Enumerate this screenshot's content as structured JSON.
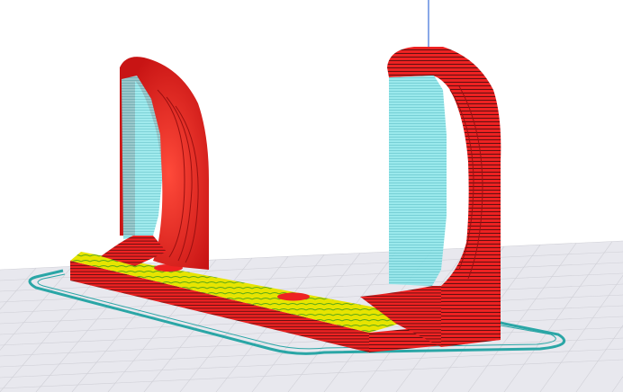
{
  "viewport": {
    "label": "",
    "colors": {
      "background": "#ffffff",
      "build_plate": "#e8e8ee",
      "grid_line": "#cfcfd6",
      "z_axis": "#3b6fd8",
      "wall_red": "#ee2222",
      "wall_red_dark": "#9a1010",
      "layer_line": "#4a0c0c",
      "support_cyan": "#8fe6ea",
      "support_line": "#4fb9c0",
      "infill_yellow": "#e7e400",
      "infill_green": "#5aa818",
      "skirt_teal": "#2aa6a6"
    },
    "objects": [
      {
        "name": "left-hook-upright",
        "type": "wall"
      },
      {
        "name": "right-hook-upright",
        "type": "wall"
      },
      {
        "name": "base-bar",
        "type": "wall"
      },
      {
        "name": "left-support",
        "type": "support"
      },
      {
        "name": "right-support",
        "type": "support"
      },
      {
        "name": "skirt-outline",
        "type": "skirt"
      }
    ]
  }
}
